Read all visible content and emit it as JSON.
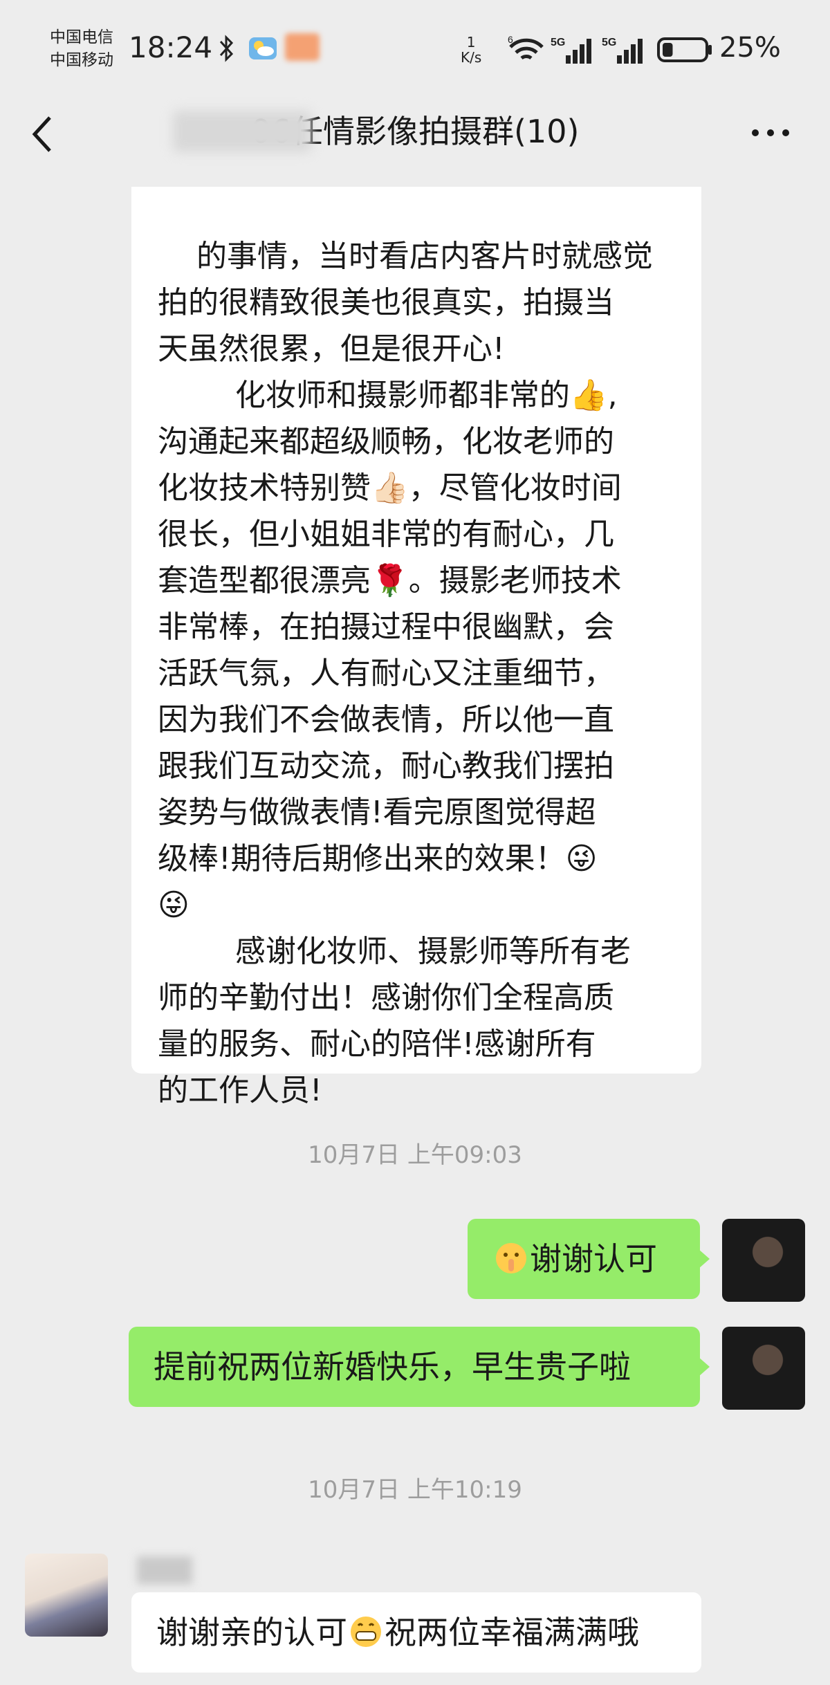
{
  "status_bar": {
    "carrier_1": "中国电信",
    "carrier_2": "中国移动",
    "time": "18:24",
    "net_speed_value": "1",
    "net_speed_unit": "K/s",
    "wifi_badge": "6",
    "sim1_badge": "5G",
    "sim2_badge": "5G",
    "battery_pct": "25%",
    "battery_level": 0.25
  },
  "nav": {
    "title": "06任情影像拍摄群(10)"
  },
  "messages": {
    "review_text": "的事情，当时看店内客片时就感觉\n拍的很精致很美也很真实，拍摄当\n天虽然很累，但是很开心!\n        化妆师和摄影师都非常的👍,\n沟通起来都超级顺畅，化妆老师的\n化妆技术特别赞👍🏻，尽管化妆时间\n很长，但小姐姐非常的有耐心，几\n套造型都很漂亮🌹。摄影老师技术\n非常棒，在拍摄过程中很幽默，会\n活跃气氛，人有耐心又注重细节，\n因为我们不会做表情，所以他一直\n跟我们互动交流，耐心教我们摆拍\n姿势与做微表情!看完原图觉得超\n级棒!期待后期修出来的效果！😜\n😜\n        感谢化妆师、摄影师等所有老\n师的辛勤付出！感谢你们全程高质\n量的服务、耐心的陪伴!感谢所有\n的工作人员!",
    "time_1": "10月7日 上午09:03",
    "self_msg_1": "谢谢认可",
    "self_msg_2": "提前祝两位新婚快乐，早生贵子啦",
    "time_2": "10月7日 上午10:19",
    "other_msg_part1": "谢谢亲的认可",
    "other_msg_part2": "祝两位幸福满满哦"
  },
  "icons": {
    "bluetooth": "bluetooth-icon",
    "weather": "weather-icon",
    "wifi": "wifi-icon",
    "signal": "signal-icon",
    "battery": "battery-icon",
    "back": "back-arrow-icon",
    "more": "more-dots-icon",
    "emoji_shush": "shushing-face-emoji",
    "emoji_grin": "grinning-face-emoji"
  },
  "colors": {
    "background": "#ededed",
    "bubble_self": "#95ec69",
    "bubble_other": "#ffffff",
    "timestamp": "#9d9d9d"
  }
}
